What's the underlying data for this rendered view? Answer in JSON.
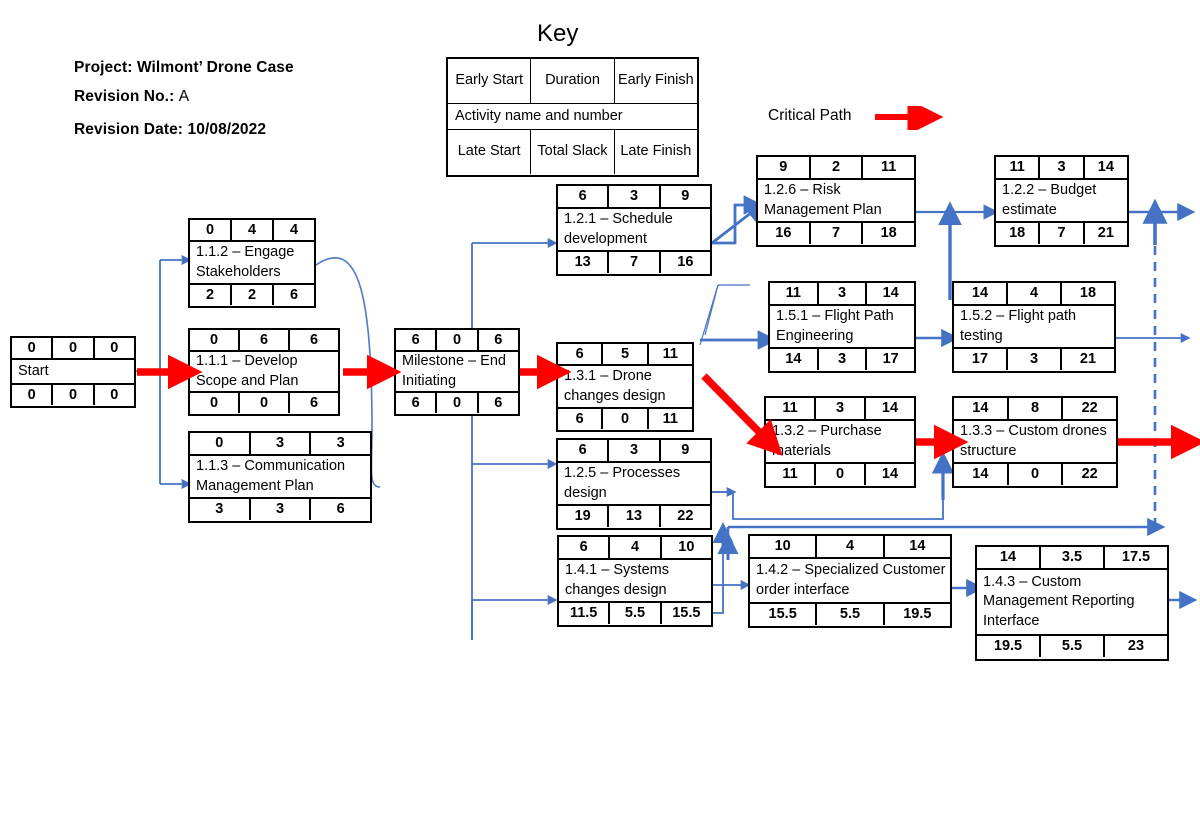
{
  "header": {
    "project_label": "Project:",
    "project_value": "Wilmont’ Drone Case",
    "revision_no_label": "Revision No.:",
    "revision_no_value": "A",
    "revision_date_label": "Revision Date:",
    "revision_date_value": "10/08/2022"
  },
  "key": {
    "title": "Key",
    "early_start": "Early Start",
    "duration": "Duration",
    "early_finish": "Early Finish",
    "activity": "Activity name and number",
    "late_start": "Late Start",
    "total_slack": "Total Slack",
    "late_finish": "Late Finish"
  },
  "legend": {
    "critical_path_label": "Critical Path",
    "critical_path_color": "#FF0000",
    "link_color": "#4472C4"
  },
  "nodes": [
    {
      "id": "start",
      "es": "0",
      "dur": "0",
      "ef": "0",
      "name": "Start",
      "ls": "0",
      "ts": "0",
      "lf": "0"
    },
    {
      "id": "n112",
      "es": "0",
      "dur": "4",
      "ef": "4",
      "name": "1.1.2 – Engage Stakeholders",
      "ls": "2",
      "ts": "2",
      "lf": "6"
    },
    {
      "id": "n111",
      "es": "0",
      "dur": "6",
      "ef": "6",
      "name": "1.1.1 – Develop Scope and Plan",
      "ls": "0",
      "ts": "0",
      "lf": "6"
    },
    {
      "id": "n113",
      "es": "0",
      "dur": "3",
      "ef": "3",
      "name": "1.1.3 – Communication Management Plan",
      "ls": "3",
      "ts": "3",
      "lf": "6"
    },
    {
      "id": "mile",
      "es": "6",
      "dur": "0",
      "ef": "6",
      "name": "Milestone – End Initiating",
      "ls": "6",
      "ts": "0",
      "lf": "6"
    },
    {
      "id": "n121",
      "es": "6",
      "dur": "3",
      "ef": "9",
      "name": "1.2.1 – Schedule development",
      "ls": "13",
      "ts": "7",
      "lf": "16"
    },
    {
      "id": "n131",
      "es": "6",
      "dur": "5",
      "ef": "11",
      "name": "1.3.1 – Drone changes design",
      "ls": "6",
      "ts": "0",
      "lf": "11"
    },
    {
      "id": "n125",
      "es": "6",
      "dur": "3",
      "ef": "9",
      "name": "1.2.5 – Processes design",
      "ls": "19",
      "ts": "13",
      "lf": "22"
    },
    {
      "id": "n141",
      "es": "6",
      "dur": "4",
      "ef": "10",
      "name": "1.4.1 – Systems changes design",
      "ls": "11.5",
      "ts": "5.5",
      "lf": "15.5"
    },
    {
      "id": "n126",
      "es": "9",
      "dur": "2",
      "ef": "11",
      "name": "1.2.6 – Risk Management Plan",
      "ls": "16",
      "ts": "7",
      "lf": "18"
    },
    {
      "id": "n122",
      "es": "11",
      "dur": "3",
      "ef": "14",
      "name": "1.2.2 – Budget estimate",
      "ls": "18",
      "ts": "7",
      "lf": "21"
    },
    {
      "id": "n151",
      "es": "11",
      "dur": "3",
      "ef": "14",
      "name": "1.5.1 – Flight Path Engineering",
      "ls": "14",
      "ts": "3",
      "lf": "17"
    },
    {
      "id": "n152",
      "es": "14",
      "dur": "4",
      "ef": "18",
      "name": "1.5.2 – Flight path testing",
      "ls": "17",
      "ts": "3",
      "lf": "21"
    },
    {
      "id": "n132",
      "es": "11",
      "dur": "3",
      "ef": "14",
      "name": "1.3.2 – Purchase materials",
      "ls": "11",
      "ts": "0",
      "lf": "14"
    },
    {
      "id": "n133",
      "es": "14",
      "dur": "8",
      "ef": "22",
      "name": "1.3.3 – Custom drones structure",
      "ls": "14",
      "ts": "0",
      "lf": "22"
    },
    {
      "id": "n142",
      "es": "10",
      "dur": "4",
      "ef": "14",
      "name": "1.4.2 – Specialized Customer order interface",
      "ls": "15.5",
      "ts": "5.5",
      "lf": "19.5"
    },
    {
      "id": "n143",
      "es": "14",
      "dur": "3.5",
      "ef": "17.5",
      "name": "1.4.3 – Custom Management Reporting Interface",
      "ls": "19.5",
      "ts": "5.5",
      "lf": "23"
    }
  ]
}
